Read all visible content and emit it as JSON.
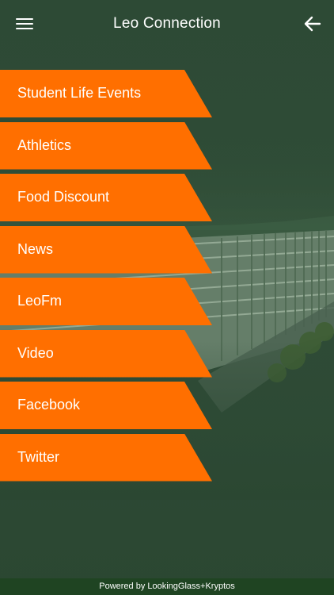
{
  "header": {
    "title": "Leo Connection",
    "menu_icon": "hamburger-menu-icon",
    "back_icon": "arrow-left-icon"
  },
  "menu": {
    "items": [
      {
        "label": "Student Life Events"
      },
      {
        "label": "Athletics"
      },
      {
        "label": "Food Discount"
      },
      {
        "label": "News"
      },
      {
        "label": "LeoFm"
      },
      {
        "label": "Video"
      },
      {
        "label": "Facebook"
      },
      {
        "label": "Twitter"
      }
    ]
  },
  "footer": {
    "text": "Powered by LookingGlass+Kryptos"
  },
  "colors": {
    "background": "#2f4c37",
    "menu_item": "#ff6f00",
    "text": "#ffffff",
    "footer": "#1f4422"
  }
}
